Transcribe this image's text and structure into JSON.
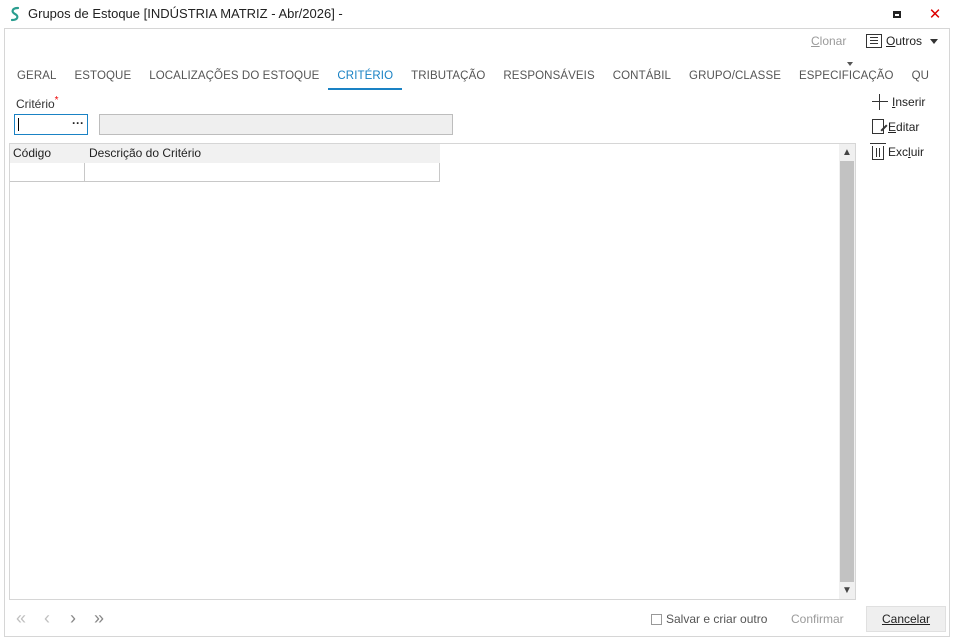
{
  "window": {
    "title": "Grupos de Estoque [INDÚSTRIA MATRIZ - Abr/2026]  -",
    "close_glyph": "✕"
  },
  "toolbar": {
    "clonar_first": "C",
    "clonar_rest": "lonar",
    "outros_first": "O",
    "outros_rest": "utros"
  },
  "tabs": [
    {
      "label": "GERAL",
      "active": false
    },
    {
      "label": "ESTOQUE",
      "active": false
    },
    {
      "label": "LOCALIZAÇÕES DO ESTOQUE",
      "active": false
    },
    {
      "label": "CRITÉRIO",
      "active": true
    },
    {
      "label": "TRIBUTAÇÃO",
      "active": false
    },
    {
      "label": "RESPONSÁVEIS",
      "active": false
    },
    {
      "label": "CONTÁBIL",
      "active": false
    },
    {
      "label": "GRUPO/CLASSE",
      "active": false
    },
    {
      "label": "ESPECIFICAÇÃO",
      "active": false
    },
    {
      "label": "QU",
      "active": false
    }
  ],
  "form": {
    "criterio_label": "Critério",
    "required_mark": "*",
    "lookup_dots": "···",
    "criterio_value": "",
    "descricao_value": ""
  },
  "grid": {
    "columns": [
      "Código",
      "Descrição do Critério"
    ],
    "rows": [
      {
        "codigo": "",
        "descricao": ""
      }
    ]
  },
  "side_actions": {
    "inserir_first": "I",
    "inserir_rest": "nserir",
    "editar_first": "E",
    "editar_rest": "ditar",
    "excluir_pre": "Exc",
    "excluir_u": "l",
    "excluir_post": "uir"
  },
  "footer": {
    "nav": [
      "«",
      "‹",
      "›",
      "»"
    ],
    "salvar_label": "Salvar e criar outro",
    "confirmar_label": "Confirmar",
    "cancelar_label": "Cancelar"
  },
  "colors": {
    "accent": "#1a82c4",
    "close": "#dd0000",
    "required": "#ee0000"
  }
}
